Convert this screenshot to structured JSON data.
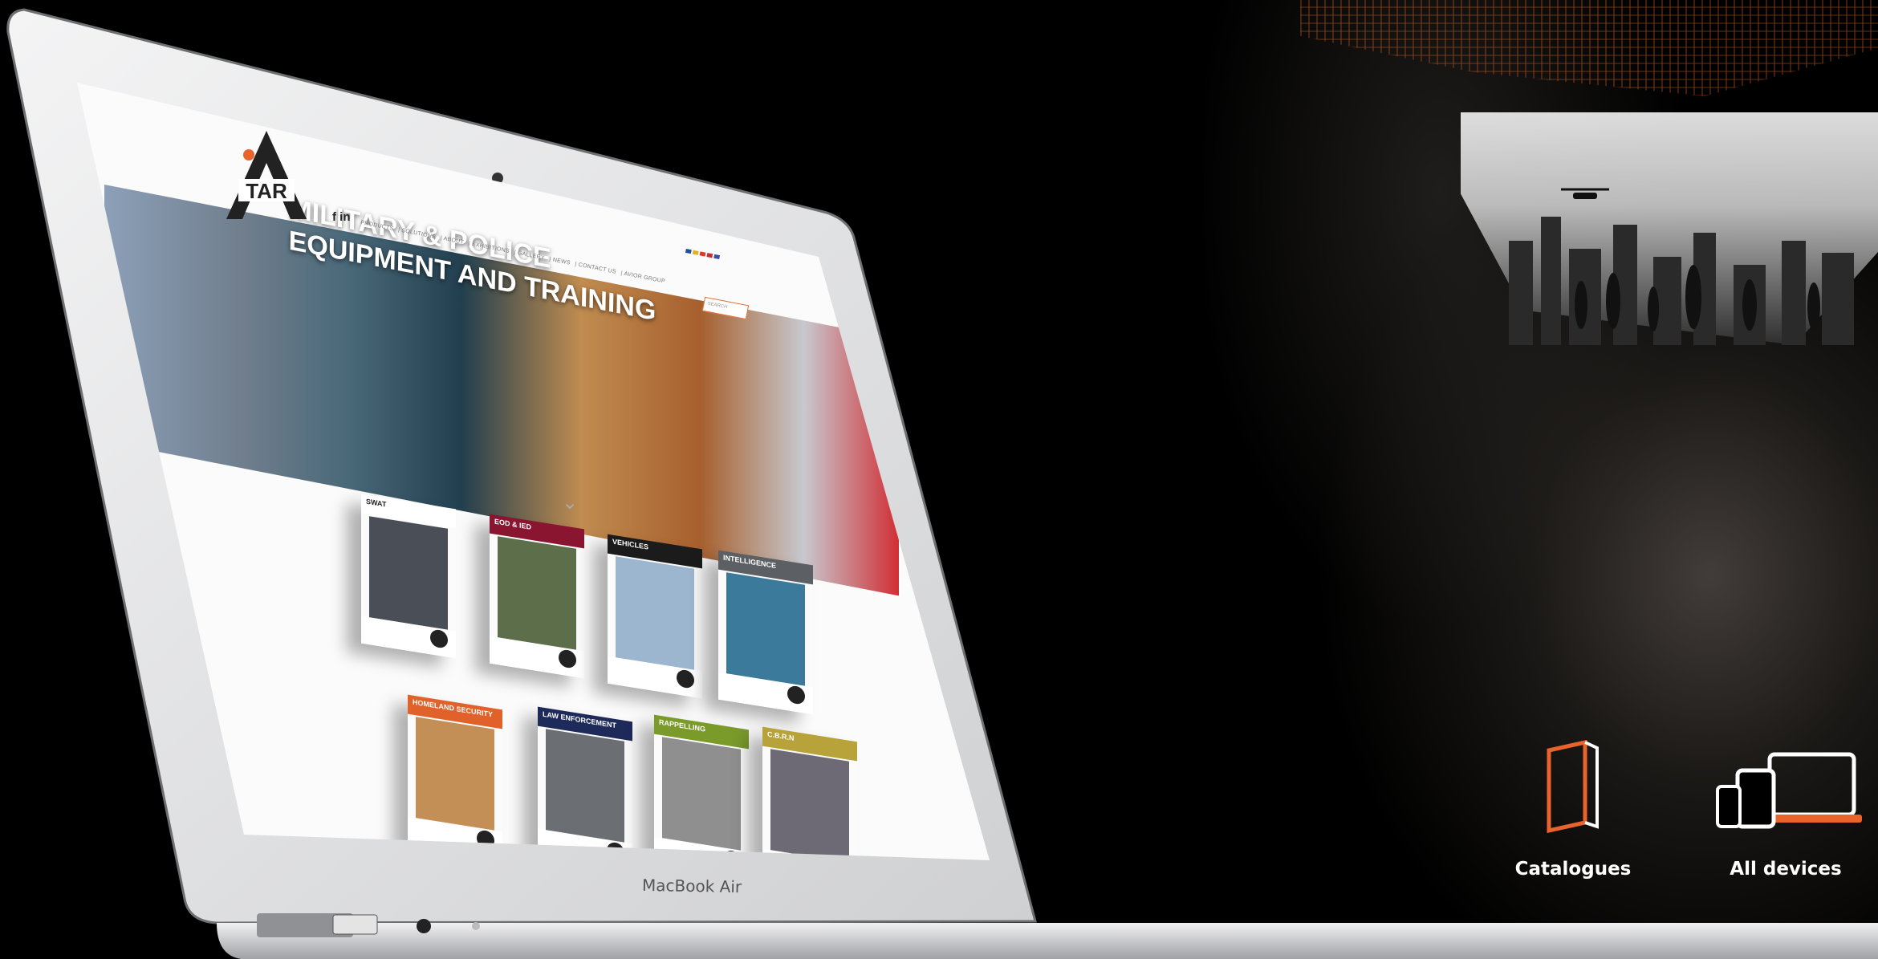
{
  "colors": {
    "accent": "#e8642a",
    "background": "#000000",
    "laptop_silver": "#d9dadc"
  },
  "device": {
    "model_label": "MacBook Air"
  },
  "site": {
    "logo_text": "TAR",
    "social": "f in",
    "nav": [
      "PRODUCTS",
      "SOLUTIONS",
      "ABOUT",
      "EXHIBITIONS",
      "GALLERY",
      "NEWS",
      "CONTACT US",
      "AVIOR GROUP"
    ],
    "search_placeholder": "SEARCH",
    "hero_line1": "MILITARY & POLICE",
    "hero_line2": "EQUIPMENT AND TRAINING",
    "catalogues": [
      {
        "title": "SWAT",
        "band_color": "#ffffff",
        "text_color": "#222222",
        "img_color": "#4a4e57"
      },
      {
        "title": "EOD & IED",
        "band_color": "#8a1530",
        "text_color": "#ffffff",
        "img_color": "#5d6e4b"
      },
      {
        "title": "VEHICLES",
        "band_color": "#1b1b1b",
        "text_color": "#ffffff",
        "img_color": "#9db6cf"
      },
      {
        "title": "INTELLIGENCE",
        "band_color": "#5c5f63",
        "text_color": "#ffffff",
        "img_color": "#3c7a9c"
      },
      {
        "title": "HOMELAND SECURITY",
        "band_color": "#e0622a",
        "text_color": "#ffffff",
        "img_color": "#c48f56"
      },
      {
        "title": "LAW ENFORCEMENT",
        "band_color": "#1e2a5a",
        "text_color": "#ffffff",
        "img_color": "#6b6f74"
      },
      {
        "title": "RAPPELLING",
        "band_color": "#7a9a2a",
        "text_color": "#ffffff",
        "img_color": "#8f8f8f"
      },
      {
        "title": "C.B.R.N",
        "band_color": "#b7a33a",
        "text_color": "#ffffff",
        "img_color": "#6e6a75"
      }
    ]
  },
  "features": [
    {
      "label": "Catalogues",
      "icon": "catalogue-book-icon"
    },
    {
      "label": "All devices",
      "icon": "all-devices-icon"
    }
  ]
}
